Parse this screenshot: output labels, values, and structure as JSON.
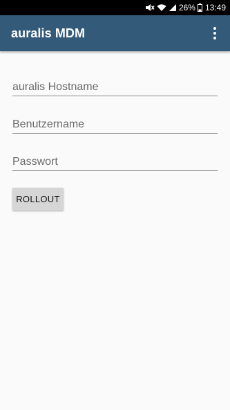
{
  "status_bar": {
    "battery_percent": "26%",
    "time": "13:49",
    "icons": [
      "mute-icon",
      "wifi-icon",
      "signal-icon",
      "battery-icon"
    ]
  },
  "app_bar": {
    "title": "auralis MDM",
    "menu_icon": "overflow-menu-icon",
    "color": "#345a7a"
  },
  "form": {
    "hostname_placeholder": "auralis Hostname",
    "username_placeholder": "Benutzername",
    "password_placeholder": "Passwort"
  },
  "actions": {
    "rollout_label": "ROLLOUT"
  }
}
